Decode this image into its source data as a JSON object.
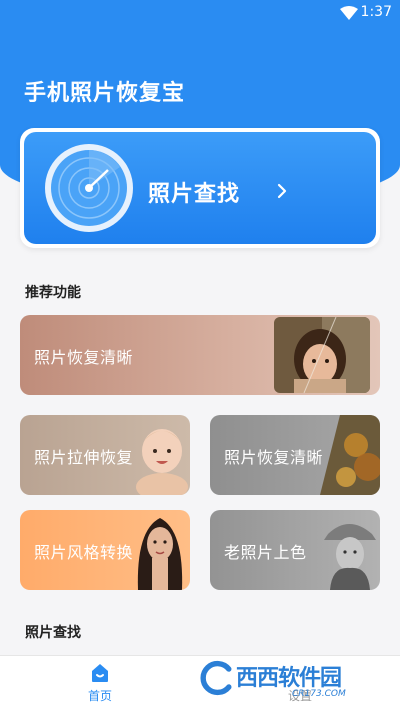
{
  "status_bar": {
    "time": "1:37"
  },
  "app": {
    "title": "手机照片恢复宝"
  },
  "search_card": {
    "label": "照片查找"
  },
  "recommended": {
    "title": "推荐功能",
    "features": [
      {
        "label": "照片恢复清晰"
      },
      {
        "label": "照片拉伸恢复"
      },
      {
        "label": "照片恢复清晰"
      },
      {
        "label": "照片风格转换"
      },
      {
        "label": "老照片上色"
      }
    ]
  },
  "photo_search_section": {
    "title": "照片查找"
  },
  "bottom_nav": {
    "home_label": "首页",
    "settings_label": "设置"
  },
  "watermark": {
    "text": "西西软件园",
    "sub": "CR173.COM"
  },
  "colors": {
    "primary": "#2a8cf2",
    "background": "#f5f5f7"
  }
}
